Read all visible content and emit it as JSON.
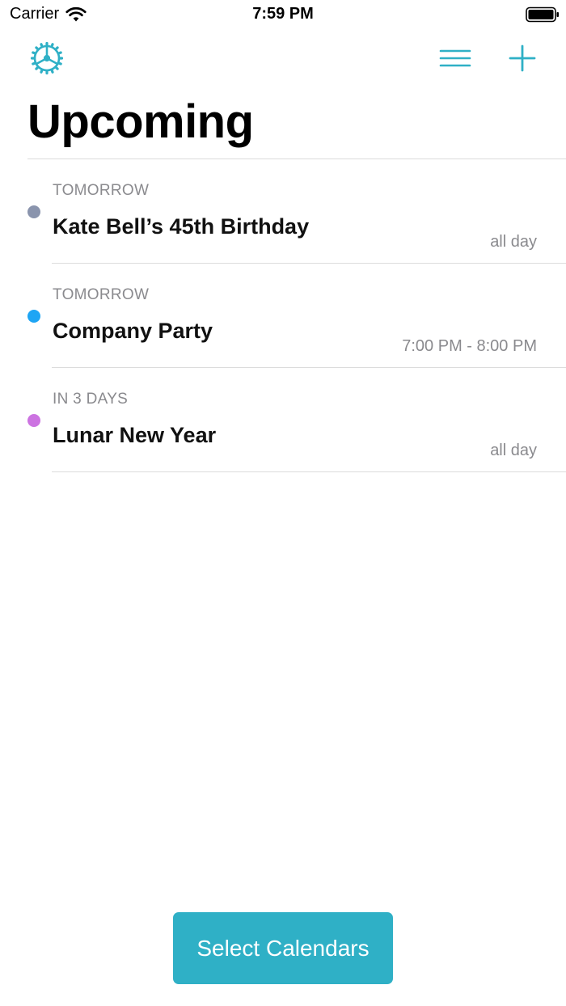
{
  "status_bar": {
    "carrier": "Carrier",
    "time": "7:59 PM"
  },
  "nav": {
    "left_icon": "gear-icon",
    "right_icons": [
      "menu-icon",
      "plus-icon"
    ],
    "accent_color": "#2fb0c6"
  },
  "page": {
    "title": "Upcoming"
  },
  "events": [
    {
      "when": "TOMORROW",
      "title": "Kate Bell’s 45th Birthday",
      "time": "all day",
      "dot_color": "#8a94ad"
    },
    {
      "when": "TOMORROW",
      "title": "Company Party",
      "time": "7:00 PM - 8:00 PM",
      "dot_color": "#1ea5f4"
    },
    {
      "when": "IN 3 DAYS",
      "title": "Lunar New Year",
      "time": "all day",
      "dot_color": "#cc73e1"
    }
  ],
  "footer": {
    "button_label": "Select Calendars",
    "button_color": "#2fb0c6"
  }
}
